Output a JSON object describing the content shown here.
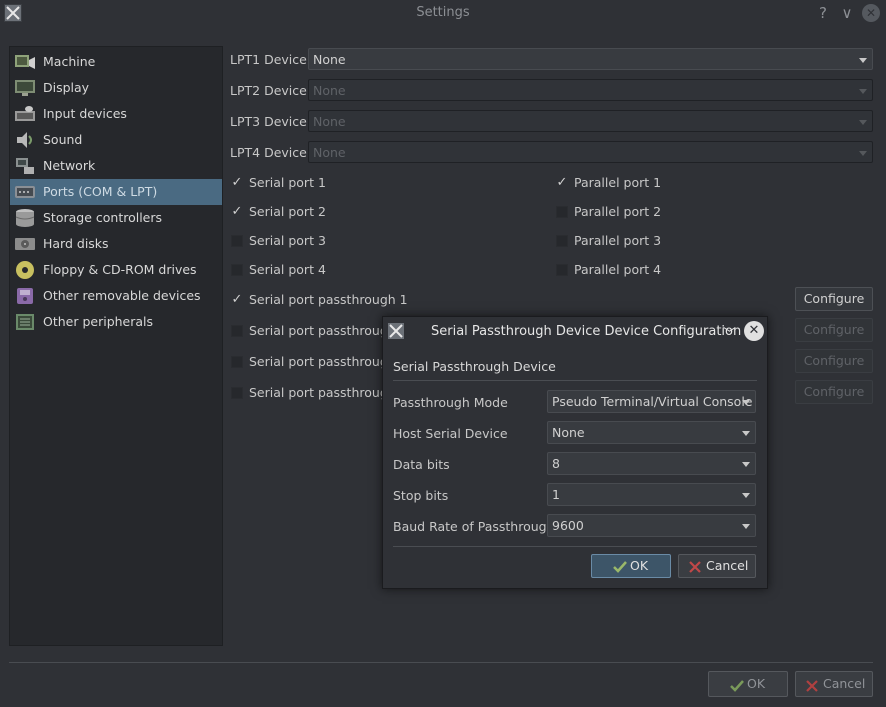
{
  "window": {
    "title": "Settings",
    "help": "?",
    "minimize": "∨",
    "close": "✕"
  },
  "sidebar": {
    "items": [
      {
        "label": "Machine",
        "icon": "machine-icon"
      },
      {
        "label": "Display",
        "icon": "display-icon"
      },
      {
        "label": "Input devices",
        "icon": "keyboard-icon"
      },
      {
        "label": "Sound",
        "icon": "speaker-icon"
      },
      {
        "label": "Network",
        "icon": "network-icon"
      },
      {
        "label": "Ports (COM & LPT)",
        "icon": "ports-icon",
        "selected": true
      },
      {
        "label": "Storage controllers",
        "icon": "storage-icon"
      },
      {
        "label": "Hard disks",
        "icon": "hard-disk-icon"
      },
      {
        "label": "Floppy & CD-ROM drives",
        "icon": "cdrom-icon"
      },
      {
        "label": "Other removable devices",
        "icon": "zip-drive-icon"
      },
      {
        "label": "Other peripherals",
        "icon": "peripherals-icon"
      }
    ]
  },
  "lpt": [
    {
      "label": "LPT1 Device:",
      "value": "None",
      "enabled": true
    },
    {
      "label": "LPT2 Device:",
      "value": "None",
      "enabled": false
    },
    {
      "label": "LPT3 Device:",
      "value": "None",
      "enabled": false
    },
    {
      "label": "LPT4 Device:",
      "value": "None",
      "enabled": false
    }
  ],
  "serial_ports": [
    {
      "label": "Serial port 1",
      "checked": true
    },
    {
      "label": "Serial port 2",
      "checked": true
    },
    {
      "label": "Serial port 3",
      "checked": false
    },
    {
      "label": "Serial port 4",
      "checked": false
    }
  ],
  "parallel_ports": [
    {
      "label": "Parallel port 1",
      "checked": true
    },
    {
      "label": "Parallel port 2",
      "checked": false
    },
    {
      "label": "Parallel port 3",
      "checked": false
    },
    {
      "label": "Parallel port 4",
      "checked": false
    }
  ],
  "passthrough": [
    {
      "label": "Serial port passthrough 1",
      "checked": true,
      "configure": "Configure",
      "configure_enabled": true
    },
    {
      "label": "Serial port passthrough",
      "checked": false,
      "configure": "Configure",
      "configure_enabled": false
    },
    {
      "label": "Serial port passthrough",
      "checked": false,
      "configure": "Configure",
      "configure_enabled": false
    },
    {
      "label": "Serial port passthrough",
      "checked": false,
      "configure": "Configure",
      "configure_enabled": false
    }
  ],
  "footer": {
    "ok": "OK",
    "cancel": "Cancel"
  },
  "dialog": {
    "title": "Serial Passthrough Device Device Configuration",
    "header": "Serial Passthrough Device",
    "fields": [
      {
        "label": "Passthrough Mode",
        "value": "Pseudo Terminal/Virtual Console"
      },
      {
        "label": "Host Serial Device",
        "value": "None"
      },
      {
        "label": "Data bits",
        "value": "8"
      },
      {
        "label": "Stop bits",
        "value": "1"
      },
      {
        "label": "Baud Rate of Passthrough",
        "value": "9600"
      }
    ],
    "ok": "OK",
    "cancel": "Cancel"
  },
  "colors": {
    "accent": "#4a6a82",
    "background": "#2f3136",
    "panel": "#26282c"
  }
}
